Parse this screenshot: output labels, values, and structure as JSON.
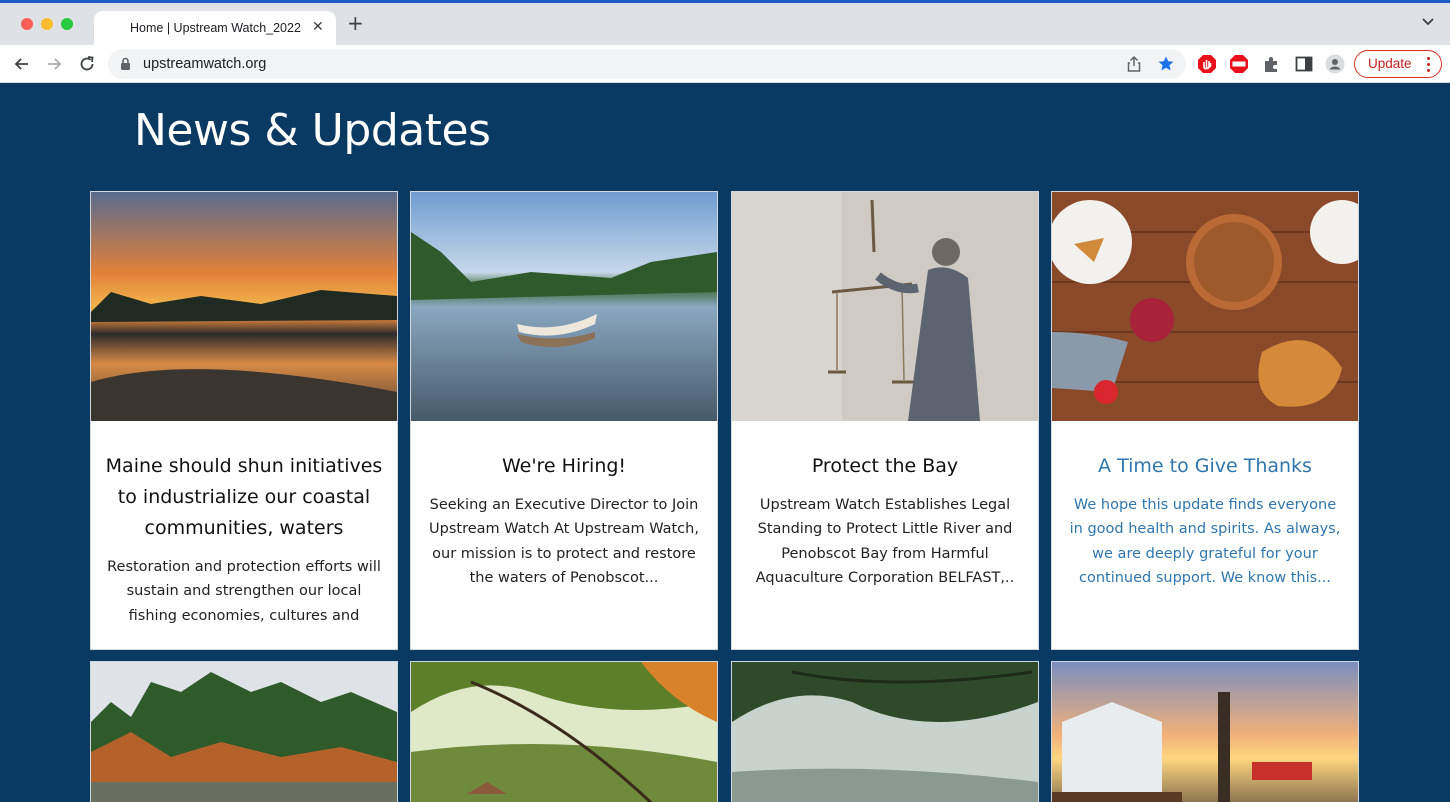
{
  "browser": {
    "tab_title": "Home | Upstream Watch_2022",
    "tab_close": "✕",
    "new_tab": "+",
    "url": "upstreamwatch.org",
    "update_label": "Update",
    "accent_color": "#1a5bc4",
    "update_color": "#d93025"
  },
  "page": {
    "heading": "News & Updates",
    "background": "#0a3a62",
    "cards": [
      {
        "title": "Maine should shun initiatives to industrialize our coastal communities, waters",
        "body": "Restoration and protection efforts will sustain and strengthen our local fishing economies, cultures and",
        "image": "sunset-shoreline"
      },
      {
        "title": "We're Hiring!",
        "body": "Seeking an Executive Director to Join Upstream Watch At Upstream Watch, our mission is to protect and restore the waters of Penobscot...",
        "image": "rowboat-lake"
      },
      {
        "title": "Protect the Bay",
        "body": "Upstream Watch Establishes Legal Standing to Protect Little River and Penobscot Bay from Harmful Aquaculture Corporation BELFAST,..",
        "image": "lady-justice-statue"
      },
      {
        "title": "A Time to Give Thanks",
        "body": "We hope this update finds everyone in good health and spirits. As always, we are deeply grateful for your continued support. We know this...",
        "image": "thanksgiving-table",
        "highlight_color": "#2f77ac"
      },
      {
        "image": "autumn-lake-trees"
      },
      {
        "image": "autumn-foliage-gazebo"
      },
      {
        "image": "misty-pine-branches"
      },
      {
        "image": "harbor-dock-sunset"
      }
    ]
  }
}
